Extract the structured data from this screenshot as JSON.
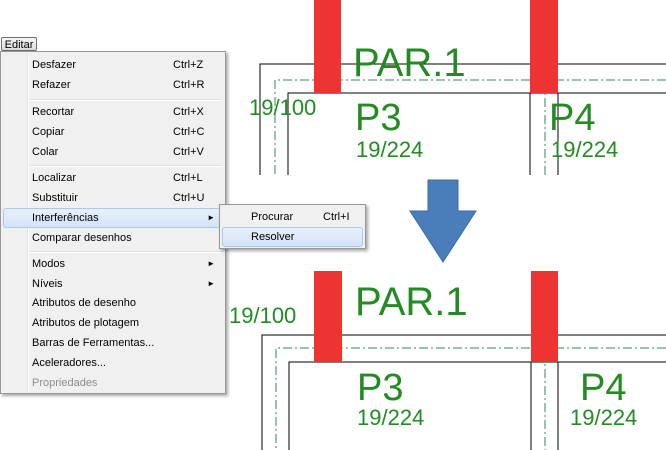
{
  "menubar": {
    "editar": "Editar"
  },
  "menu": {
    "items": [
      {
        "label": "Desfazer",
        "shortcut": "Ctrl+Z"
      },
      {
        "label": "Refazer",
        "shortcut": "Ctrl+R"
      },
      {
        "label": "Recortar",
        "shortcut": "Ctrl+X"
      },
      {
        "label": "Copiar",
        "shortcut": "Ctrl+C"
      },
      {
        "label": "Colar",
        "shortcut": "Ctrl+V"
      },
      {
        "label": "Localizar",
        "shortcut": "Ctrl+L"
      },
      {
        "label": "Substituir",
        "shortcut": "Ctrl+U"
      },
      {
        "label": "Interferências",
        "submenu_arrow": "►"
      },
      {
        "label": "Comparar desenhos"
      },
      {
        "label": "Modos",
        "submenu_arrow": "►"
      },
      {
        "label": "Níveis",
        "submenu_arrow": "►"
      },
      {
        "label": "Atributos de desenho"
      },
      {
        "label": "Atributos de plotagem"
      },
      {
        "label": "Barras de Ferramentas..."
      },
      {
        "label": "Aceleradores..."
      },
      {
        "label": "Propriedades",
        "disabled": true
      }
    ]
  },
  "submenu": {
    "items": [
      {
        "label": "Procurar",
        "shortcut": "Ctrl+I"
      },
      {
        "label": "Resolver"
      }
    ]
  },
  "drawing": {
    "before": {
      "par": "PAR.1",
      "dim_left": "19/100",
      "p3": "P3",
      "p3_dim": "19/224",
      "p4": "P4",
      "p4_dim": "19/224"
    },
    "after": {
      "par": "PAR.1",
      "dim_left": "19/100",
      "p3": "P3",
      "p3_dim": "19/224",
      "p4": "P4",
      "p4_dim": "19/224"
    }
  },
  "colors": {
    "text": "#228b22",
    "pillar": "#ee3333",
    "arrow": "#4a7ebb",
    "menu_bg": "#f0f0f0",
    "highlight": "#d4e3f7"
  },
  "icons": {
    "submenu_arrow": "triangle-right",
    "transition_arrow": "arrow-down"
  }
}
